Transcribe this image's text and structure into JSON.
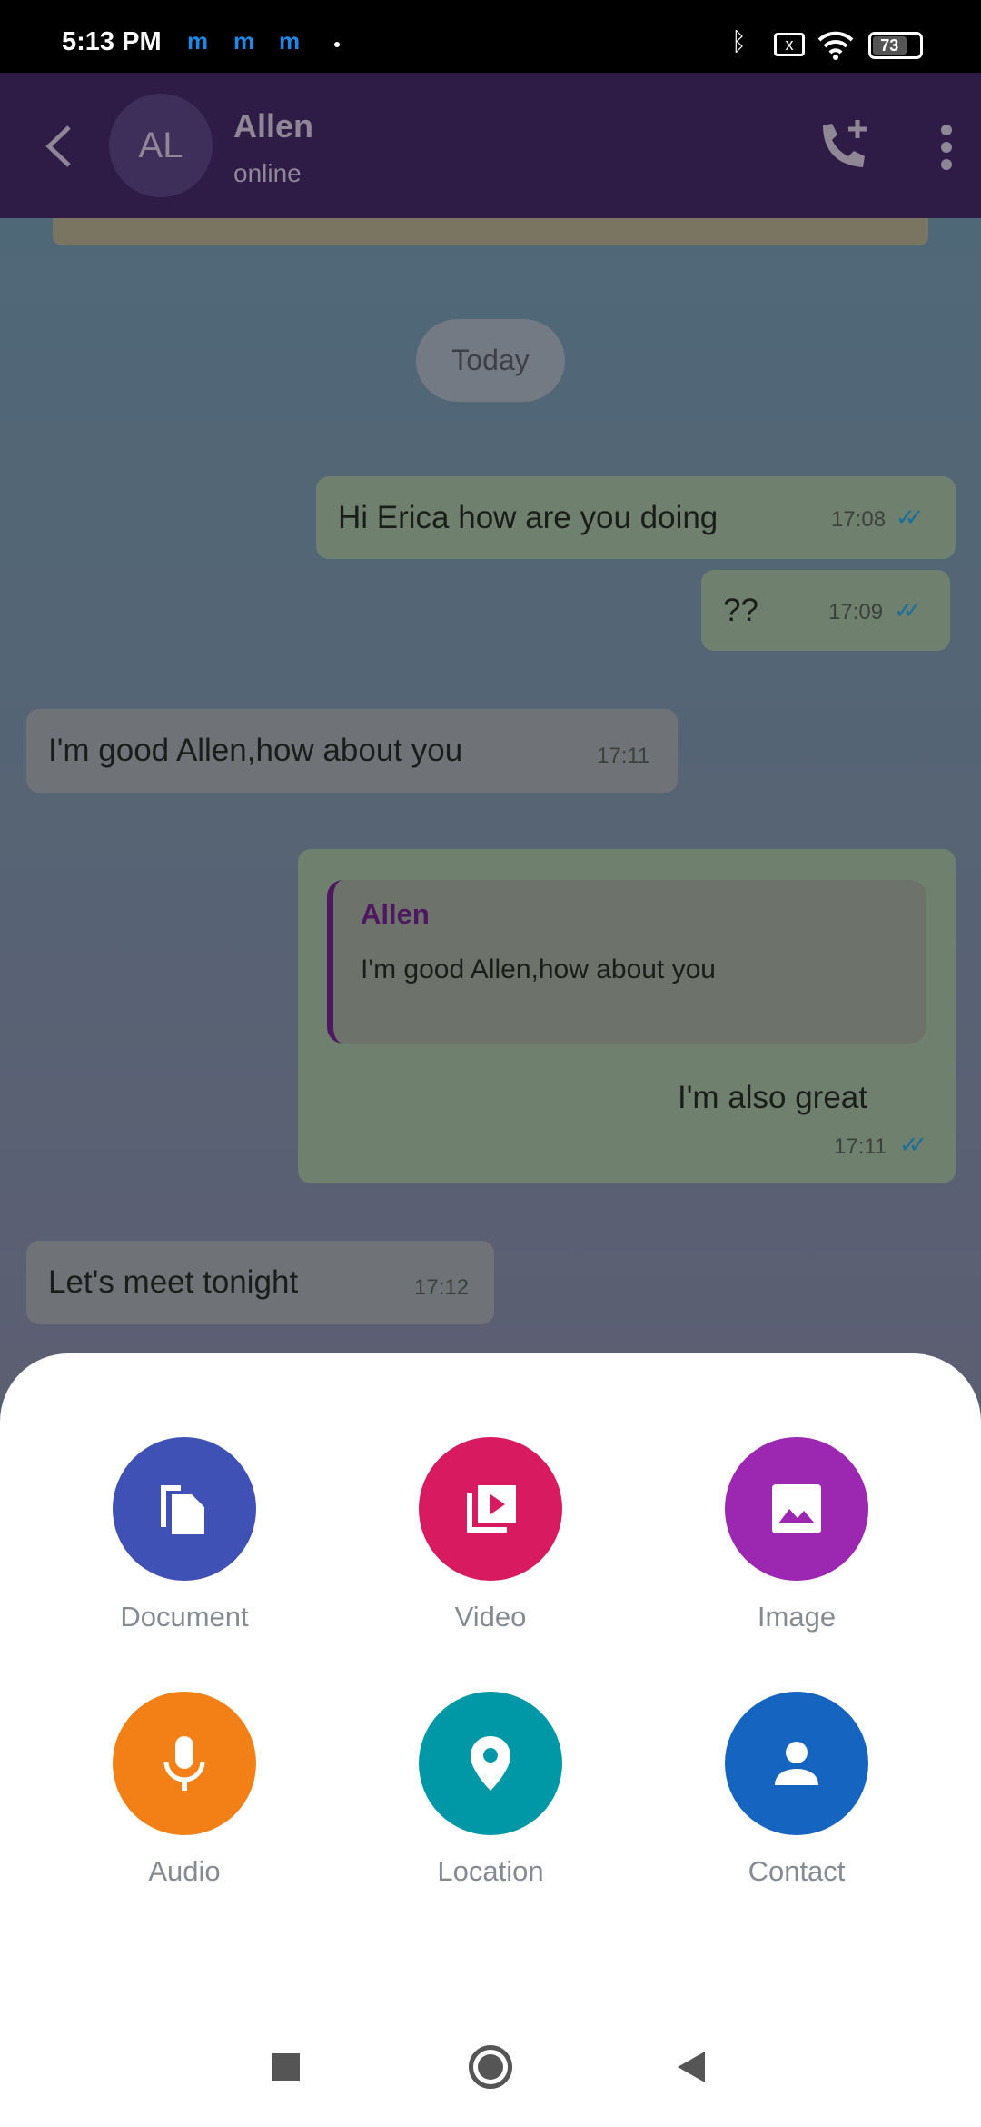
{
  "status_bar": {
    "time": "5:13 PM",
    "notif": [
      "m",
      "m",
      "m"
    ],
    "battery": "73"
  },
  "header": {
    "avatar_initials": "AL",
    "name": "Allen",
    "status": "online"
  },
  "chat": {
    "date_label": "Today",
    "messages": [
      {
        "dir": "out",
        "text": "Hi Erica how are you doing",
        "time": "17:08"
      },
      {
        "dir": "out",
        "text": "??",
        "time": "17:09"
      },
      {
        "dir": "in",
        "text": "I'm good Allen,how about you",
        "time": "17:11"
      },
      {
        "dir": "out",
        "reply_to": {
          "author": "Allen",
          "text": "I'm good Allen,how about you"
        },
        "text": "I'm also great",
        "time": "17:11"
      },
      {
        "dir": "in",
        "text": "Let's meet tonight",
        "time": "17:12"
      }
    ]
  },
  "attach_sheet": {
    "items": [
      {
        "label": "Document",
        "icon": "document-icon",
        "color": "#3f51b5"
      },
      {
        "label": "Video",
        "icon": "video-library-icon",
        "color": "#d81b60"
      },
      {
        "label": "Image",
        "icon": "image-icon",
        "color": "#9c27b0"
      },
      {
        "label": "Audio",
        "icon": "mic-icon",
        "color": "#f37f17"
      },
      {
        "label": "Location",
        "icon": "location-pin-icon",
        "color": "#0097a7"
      },
      {
        "label": "Contact",
        "icon": "person-icon",
        "color": "#1565c0"
      }
    ]
  }
}
